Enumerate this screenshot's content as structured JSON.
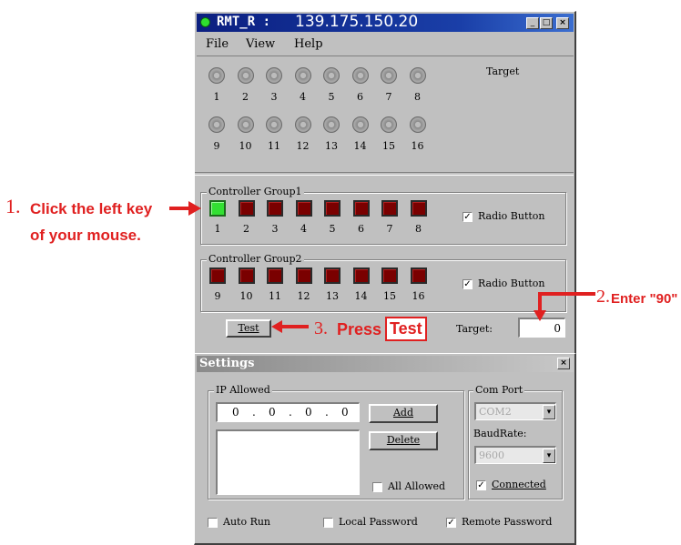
{
  "window": {
    "title_prefix": "RMT_R :",
    "title_ip": "139.175.150.20",
    "min_glyph": "_",
    "max_glyph": "□",
    "close_glyph": "×"
  },
  "menu": {
    "file": "File",
    "view": "View",
    "help": "Help"
  },
  "target_panel": {
    "label": "Target",
    "row1": [
      "1",
      "2",
      "3",
      "4",
      "5",
      "6",
      "7",
      "8"
    ],
    "row2": [
      "9",
      "10",
      "11",
      "12",
      "13",
      "14",
      "15",
      "16"
    ]
  },
  "controller": {
    "group1": {
      "label": "Controller Group1",
      "numbers": [
        "1",
        "2",
        "3",
        "4",
        "5",
        "6",
        "7",
        "8"
      ],
      "radio_label": "Radio Button",
      "checked": "✓"
    },
    "group2": {
      "label": "Controller Group2",
      "numbers": [
        "9",
        "10",
        "11",
        "12",
        "13",
        "14",
        "15",
        "16"
      ],
      "radio_label": "Radio Button",
      "checked": "✓"
    },
    "test_button": "Test",
    "target_label": "Target:",
    "target_value": "0"
  },
  "settings": {
    "title": "Settings",
    "close_glyph": "×",
    "ip_allowed": {
      "label": "IP Allowed",
      "ip": [
        "0",
        "0",
        "0",
        "0"
      ],
      "add": "Add",
      "delete": "Delete",
      "all_allowed": "All Allowed"
    },
    "com_port": {
      "label": "Com Port",
      "value": "COM2",
      "baud_label": "BaudRate:",
      "baud_value": "9600",
      "connected": "Connected",
      "connected_check": "✓"
    },
    "auto_run": "Auto Run",
    "local_password": "Local Password",
    "remote_password": "Remote Password",
    "remote_check": "✓"
  },
  "annotations": {
    "step1_num": "1.",
    "step1_line1": "Click the left key",
    "step1_line2": "of your mouse.",
    "step2_num": "2.",
    "step2_text": "Enter \"90\"",
    "step3_num": "3.",
    "step3_text": "Press",
    "step3_box": "Test"
  },
  "colors": {
    "annotation": "#e02020",
    "led_on": "#33e033",
    "led_off": "#7a0000",
    "titlebar": "#0b1f80"
  }
}
